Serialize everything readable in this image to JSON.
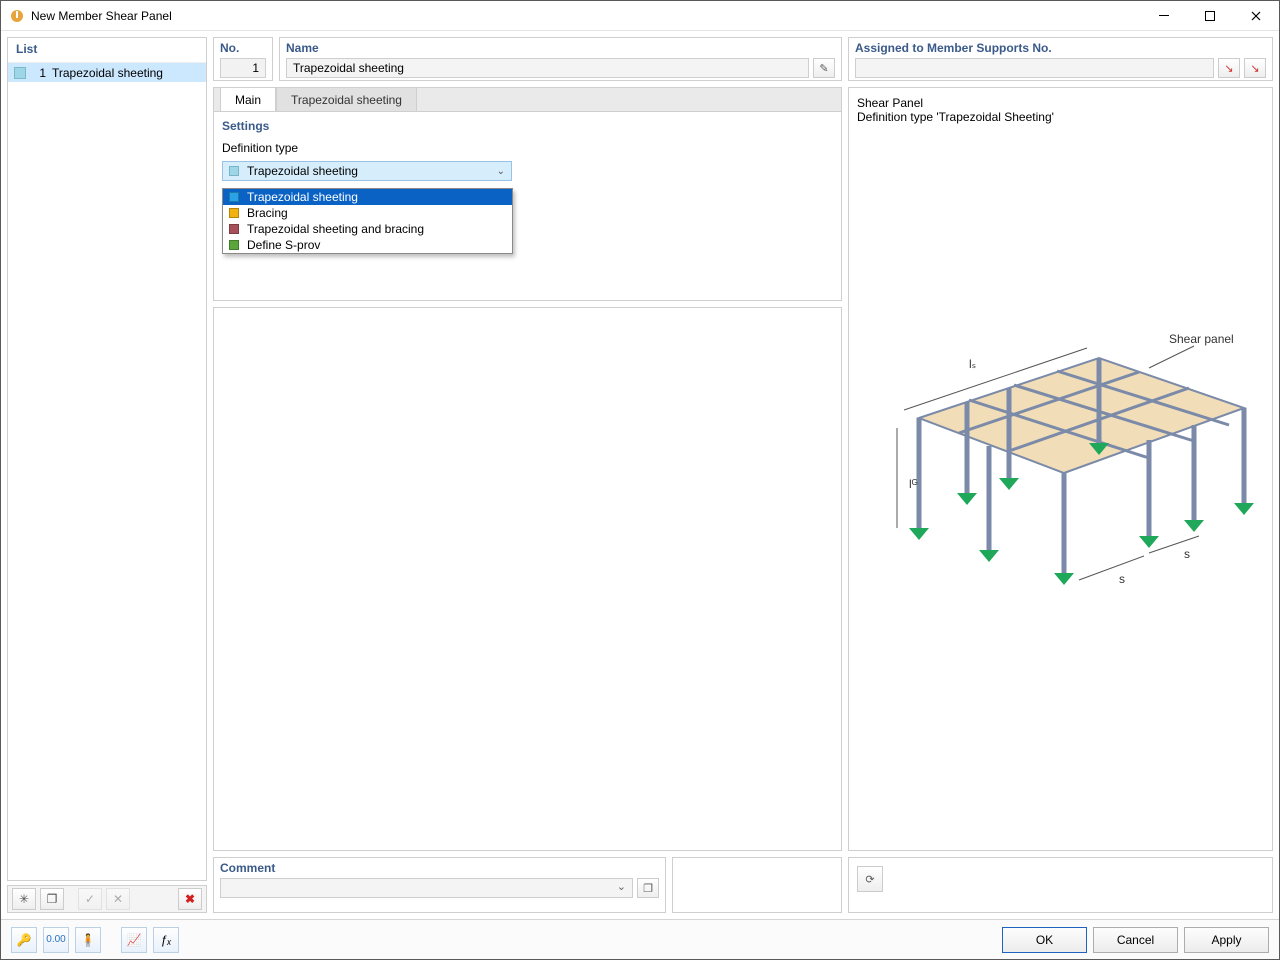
{
  "window": {
    "title": "New Member Shear Panel"
  },
  "list": {
    "header": "List",
    "items": [
      {
        "no": "1",
        "label": "Trapezoidal sheeting"
      }
    ]
  },
  "no": {
    "label": "No.",
    "value": "1"
  },
  "name": {
    "label": "Name",
    "value": "Trapezoidal sheeting"
  },
  "assigned": {
    "label": "Assigned to Member Supports No."
  },
  "tabs": {
    "main": "Main",
    "trap": "Trapezoidal sheeting"
  },
  "settings": {
    "header": "Settings",
    "def_label": "Definition type",
    "selected": "Trapezoidal sheeting",
    "options": [
      {
        "label": "Trapezoidal sheeting",
        "color": "#2aa3e6",
        "selected": true
      },
      {
        "label": "Bracing",
        "color": "#f2b20f"
      },
      {
        "label": "Trapezoidal sheeting and bracing",
        "color": "#a8505a"
      },
      {
        "label": "Define S-prov",
        "color": "#5aa63a"
      }
    ]
  },
  "preview": {
    "line1": "Shear Panel",
    "line2": "Definition type 'Trapezoidal Sheeting'",
    "labels": {
      "shear_panel": "Shear panel",
      "ls": "lₛ",
      "lg": "lᴳ",
      "s1": "s",
      "s2": "s"
    }
  },
  "comment": {
    "header": "Comment"
  },
  "buttons": {
    "ok": "OK",
    "cancel": "Cancel",
    "apply": "Apply"
  }
}
